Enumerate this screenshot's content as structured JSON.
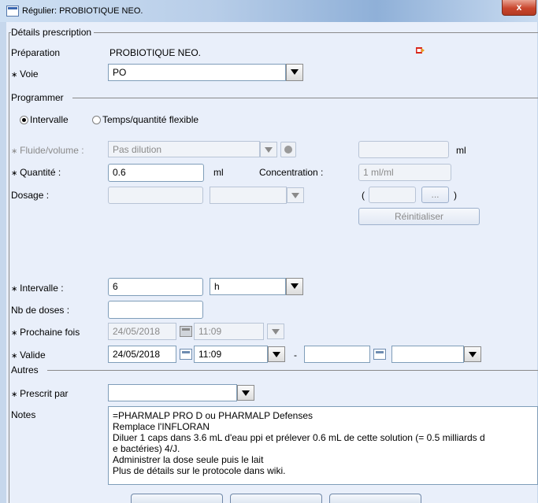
{
  "window": {
    "title": "Régulier: PROBIOTIQUE NEO.",
    "close_label": "x"
  },
  "details": {
    "group_title": "Détails prescription",
    "preparation_label": "Préparation",
    "preparation_value": "PROBIOTIQUE NEO.",
    "voie_label": "Voie",
    "voie_value": "PO"
  },
  "programmer": {
    "group_title": "Programmer",
    "radio_intervalle": "Intervalle",
    "radio_flexible": "Temps/quantité flexible",
    "selected": "Intervalle",
    "fluide_label": "Fluide/volume :",
    "fluide_value": "Pas dilution",
    "fluide_unit": "ml",
    "fluide_volume_value": "",
    "quantite_label": "Quantité :",
    "quantite_value": "0.6",
    "quantite_unit": "ml",
    "concentration_label": "Concentration :",
    "concentration_value": "1 ml/ml",
    "dosage_label": "Dosage :",
    "dosage_value": "",
    "dosage_unit_value": "",
    "paren_open": "(",
    "paren_close": ")",
    "ellipsis_button": "...",
    "reinitialiser_button": "Réinitialiser",
    "intervalle_label": "Intervalle :",
    "intervalle_value": "6",
    "intervalle_unit": "h",
    "nb_doses_label": "Nb de doses :",
    "nb_doses_value": "",
    "prochaine_label": "Prochaine fois",
    "prochaine_date": "24/05/2018",
    "prochaine_time": "11:09",
    "valide_label": "Valide",
    "valide_date": "24/05/2018",
    "valide_time": "11:09",
    "valide_dash": "-",
    "valide_end_date": "",
    "valide_end_time": ""
  },
  "autres": {
    "group_title": "Autres",
    "prescrit_label": "Prescrit par",
    "prescrit_value": "",
    "notes_label": "Notes",
    "notes_lines": [
      "=PHARMALP PRO D ou PHARMALP Defenses",
      "Remplace l'INFLORAN",
      "Diluer 1 caps dans 3.6 mL d'eau ppi et prélever 0.6 mL de cette solution (= 0.5 milliards d",
      "e bactéries) 4/J.",
      "Administrer la dose seule puis le lait",
      "Plus de détails sur le protocole dans wiki."
    ]
  },
  "colors": {
    "window_bg": "#c6d7ec",
    "panel_bg": "#e9effa",
    "close_red": "#c9462d",
    "field_border": "#7f9db9"
  },
  "icons": {
    "app": "app-window-icon",
    "close": "close-icon",
    "export": "export-pdf-icon",
    "calendar": "calendar-icon",
    "dropdown": "chevron-down-icon",
    "info": "info-circle-icon"
  }
}
